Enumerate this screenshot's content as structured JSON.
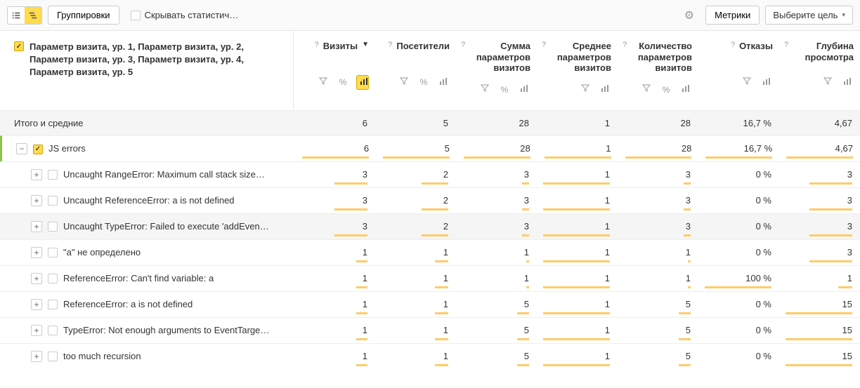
{
  "toolbar": {
    "groupings_label": "Группировки",
    "hide_statistic_label": "Скрывать статистич…",
    "metrics_label": "Метрики",
    "select_goal_label": "Выберите цель"
  },
  "dimensions_title": "Параметр визита, ур. 1, Параметр визита, ур. 2, Параметр визита, ур. 3, Параметр визита, ур. 4, Параметр визита, ур. 5",
  "columns": [
    {
      "id": "visits",
      "label": "Визиты",
      "sorted": true,
      "filters": [
        "filter",
        "pct",
        "chart_active"
      ]
    },
    {
      "id": "visitors",
      "label": "Посетители",
      "filters": [
        "filter",
        "pct",
        "chart"
      ]
    },
    {
      "id": "sum_params",
      "label": "Сумма параметров визитов",
      "filters": [
        "filter",
        "pct",
        "chart"
      ]
    },
    {
      "id": "avg_params",
      "label": "Среднее параметров визитов",
      "filters": [
        "filter",
        "chart"
      ]
    },
    {
      "id": "count_params",
      "label": "Количество параметров визитов",
      "filters": [
        "filter",
        "pct",
        "chart"
      ]
    },
    {
      "id": "bounces",
      "label": "Отказы",
      "filters": [
        "filter",
        "chart"
      ]
    },
    {
      "id": "depth",
      "label": "Глубина просмотра",
      "filters": [
        "filter",
        "chart"
      ]
    }
  ],
  "totals_label": "Итого и средние",
  "totals_values": [
    "6",
    "5",
    "28",
    "1",
    "28",
    "16,7 %",
    "4,67"
  ],
  "group_row": {
    "label": "JS errors",
    "values": [
      "6",
      "5",
      "28",
      "1",
      "28",
      "16,7 %",
      "4,67"
    ],
    "bars": [
      100,
      100,
      100,
      100,
      100,
      100,
      100
    ]
  },
  "rows": [
    {
      "label": "Uncaught RangeError: Maximum call stack size…",
      "values": [
        "3",
        "2",
        "3",
        "1",
        "3",
        "0 %",
        "3"
      ],
      "bars": [
        50,
        40,
        11,
        100,
        11,
        0,
        64
      ],
      "hover": false
    },
    {
      "label": "Uncaught ReferenceError: a is not defined",
      "values": [
        "3",
        "2",
        "3",
        "1",
        "3",
        "0 %",
        "3"
      ],
      "bars": [
        50,
        40,
        11,
        100,
        11,
        0,
        64
      ],
      "hover": false
    },
    {
      "label": "Uncaught TypeError: Failed to execute 'addEven…",
      "values": [
        "3",
        "2",
        "3",
        "1",
        "3",
        "0 %",
        "3"
      ],
      "bars": [
        50,
        40,
        11,
        100,
        11,
        0,
        64
      ],
      "hover": true
    },
    {
      "label": "\"a\" не определено",
      "values": [
        "1",
        "1",
        "1",
        "1",
        "1",
        "0 %",
        "3"
      ],
      "bars": [
        17,
        20,
        4,
        100,
        4,
        0,
        64
      ],
      "hover": false
    },
    {
      "label": "ReferenceError: Can't find variable: a",
      "values": [
        "1",
        "1",
        "1",
        "1",
        "1",
        "100 %",
        "1"
      ],
      "bars": [
        17,
        20,
        4,
        100,
        4,
        100,
        21
      ],
      "hover": false
    },
    {
      "label": "ReferenceError: a is not defined",
      "values": [
        "1",
        "1",
        "5",
        "1",
        "5",
        "0 %",
        "15"
      ],
      "bars": [
        17,
        20,
        18,
        100,
        18,
        0,
        100
      ],
      "hover": false
    },
    {
      "label": "TypeError: Not enough arguments to EventTarge…",
      "values": [
        "1",
        "1",
        "5",
        "1",
        "5",
        "0 %",
        "15"
      ],
      "bars": [
        17,
        20,
        18,
        100,
        18,
        0,
        100
      ],
      "hover": false
    },
    {
      "label": "too much recursion",
      "values": [
        "1",
        "1",
        "5",
        "1",
        "5",
        "0 %",
        "15"
      ],
      "bars": [
        17,
        20,
        18,
        100,
        18,
        0,
        100
      ],
      "hover": false
    }
  ]
}
